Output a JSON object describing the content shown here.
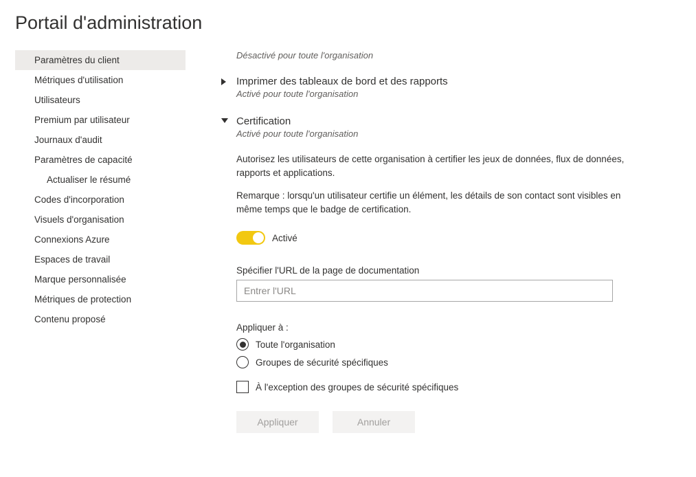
{
  "page_title": "Portail d'administration",
  "sidebar": {
    "items": [
      {
        "label": "Paramètres du client",
        "active": true
      },
      {
        "label": "Métriques d'utilisation"
      },
      {
        "label": "Utilisateurs"
      },
      {
        "label": "Premium par utilisateur"
      },
      {
        "label": "Journaux d'audit"
      },
      {
        "label": "Paramètres de capacité"
      },
      {
        "label": "Actualiser le résumé",
        "sub": true
      },
      {
        "label": "Codes d'incorporation"
      },
      {
        "label": "Visuels d'organisation"
      },
      {
        "label": "Connexions Azure"
      },
      {
        "label": "Espaces de travail"
      },
      {
        "label": "Marque personnalisée"
      },
      {
        "label": "Métriques de protection"
      },
      {
        "label": "Contenu proposé"
      }
    ]
  },
  "stub_section_subtitle": "Désactivé pour toute l'organisation",
  "print_section": {
    "title": "Imprimer des tableaux de bord et des rapports",
    "subtitle": "Activé pour toute l'organisation"
  },
  "cert_section": {
    "title": "Certification",
    "subtitle": "Activé pour toute l'organisation",
    "desc1": "Autorisez les utilisateurs de cette organisation à certifier les jeux de données, flux de données, rapports et applications.",
    "desc2": "Remarque : lorsqu'un utilisateur certifie un élément, les détails de son contact sont visibles en même temps que le badge de certification.",
    "toggle_label": "Activé",
    "url_label": "Spécifier l'URL de la page de documentation",
    "url_placeholder": "Entrer l'URL",
    "url_value": "",
    "apply_to_label": "Appliquer à :",
    "radio_all": "Toute l'organisation",
    "radio_groups": "Groupes de sécurité spécifiques",
    "except_label": "À l'exception des groupes de sécurité spécifiques",
    "apply_btn": "Appliquer",
    "cancel_btn": "Annuler"
  }
}
